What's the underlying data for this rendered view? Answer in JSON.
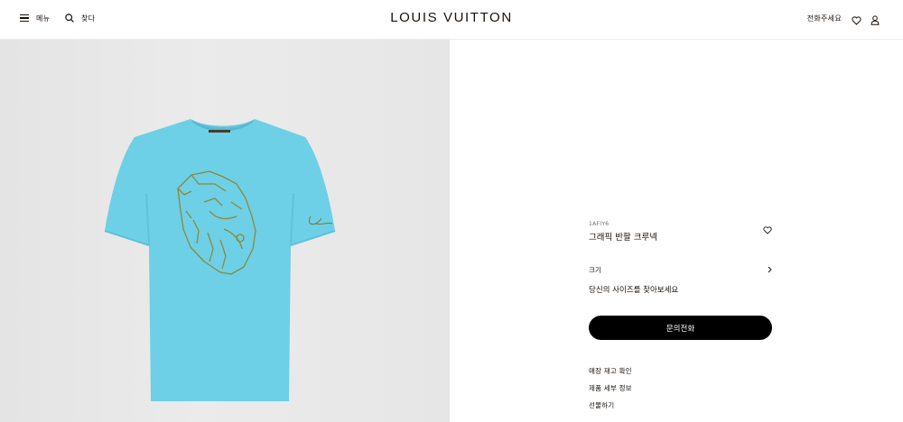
{
  "header": {
    "menu_label": "메뉴",
    "search_label": "찾다",
    "logo": "LOUIS VUITTON",
    "call_label": "전화주세요"
  },
  "product": {
    "image_alt": "그래픽 반팔 크루넥",
    "colors": {
      "shirt": "#6dd0e6",
      "embroidery": "#8a8a3a",
      "background": "#e8e8e8"
    },
    "sku": "1AFIY6",
    "name": "그래픽 반팔 크루넥",
    "size_label": "크기",
    "size_guide": "당신의 사이즈를 찾아보세요",
    "cta_label": "문의전화",
    "links": [
      "매장 재고 확인",
      "제품 세부 정보",
      "선물하기"
    ]
  }
}
